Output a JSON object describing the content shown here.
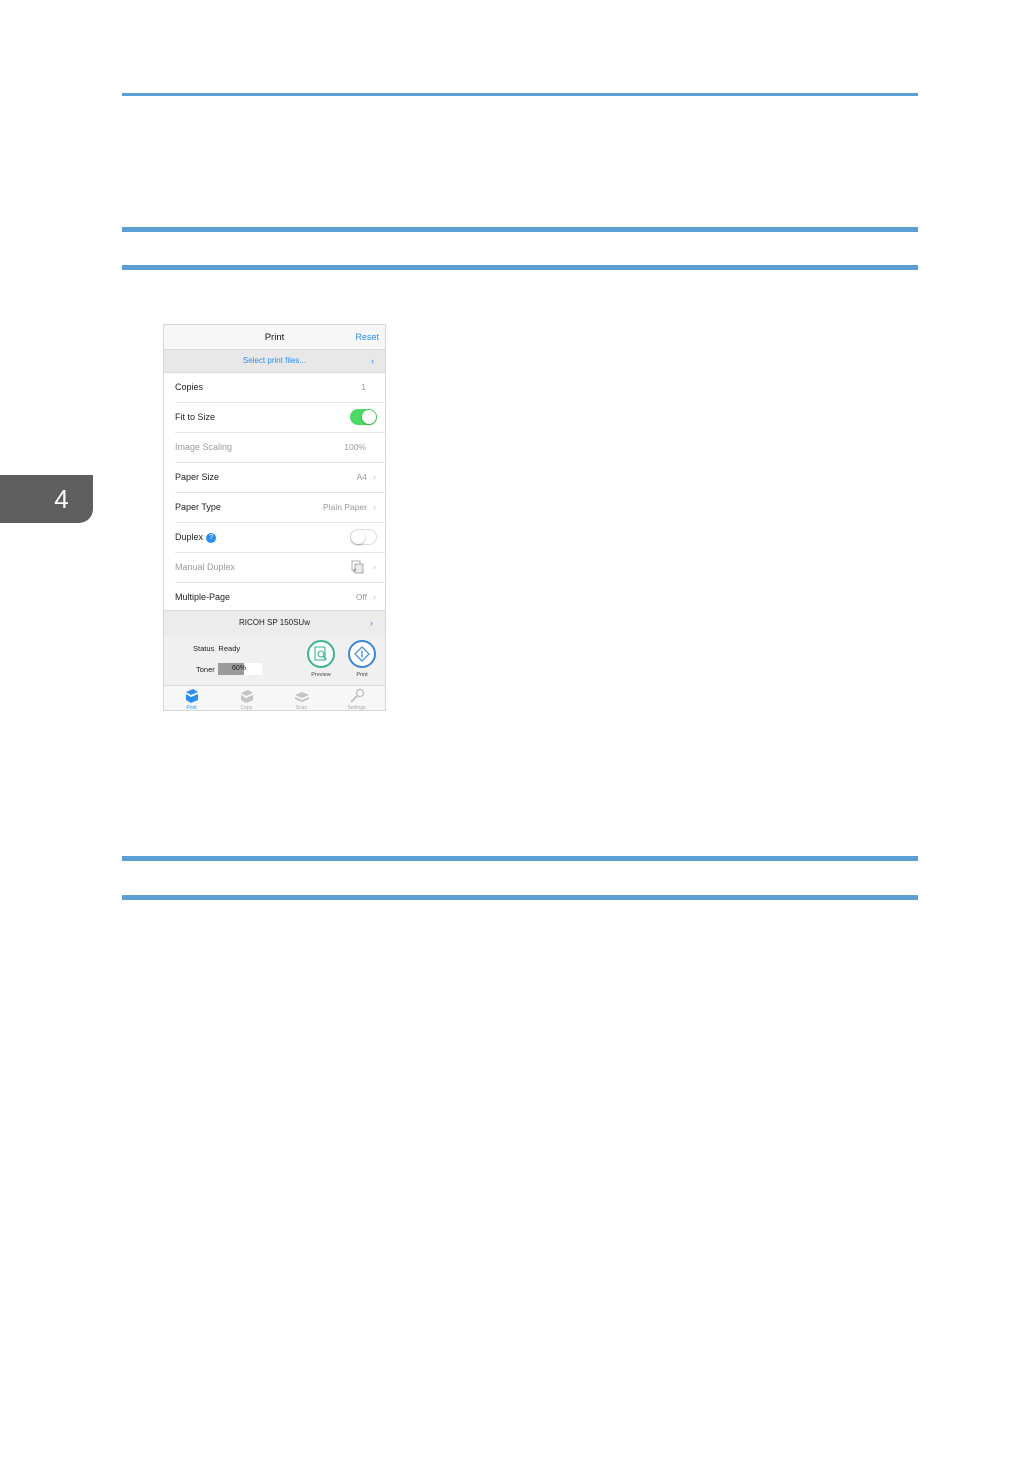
{
  "chapter": {
    "number": "4"
  },
  "phone": {
    "nav": {
      "title": "Print",
      "reset_label": "Reset"
    },
    "select_files": {
      "label": "Select print files...",
      "chevron": "›"
    },
    "settings": [
      {
        "label": "Copies",
        "value": "1"
      },
      {
        "label": "Fit to Size",
        "toggle": true
      },
      {
        "label": "Image Scaling",
        "value": "100%",
        "disabled": true
      },
      {
        "label": "Paper Size",
        "value": "A4"
      },
      {
        "label": "Paper Type",
        "value": "Plain Paper"
      },
      {
        "label": "Duplex",
        "help": "?",
        "toggle": false
      },
      {
        "label": "Manual Duplex",
        "disabled": true,
        "icon": "manual-duplex-icon"
      },
      {
        "label": "Multiple-Page",
        "value": "Off"
      }
    ],
    "printer": {
      "name": "RICOH SP 150SUw",
      "chevron": "›"
    },
    "status": {
      "text": "Status  Ready",
      "toner_label": "Toner",
      "toner_percent_text": "60%",
      "toner_level": 0.6
    },
    "actions": {
      "preview_label": "Preview",
      "print_label": "Print"
    },
    "tabs": [
      {
        "label": "Print",
        "icon": "print-tab-icon",
        "active": true
      },
      {
        "label": "Copy",
        "icon": "copy-tab-icon",
        "active": false
      },
      {
        "label": "Scan",
        "icon": "scan-tab-icon",
        "active": false
      },
      {
        "label": "Settings",
        "icon": "settings-tab-icon",
        "active": false
      }
    ],
    "colors": {
      "accent": "#2a8ff0",
      "toggle_on": "#4cd964",
      "preview": "#3cb48b",
      "print": "#3d86d6"
    }
  }
}
